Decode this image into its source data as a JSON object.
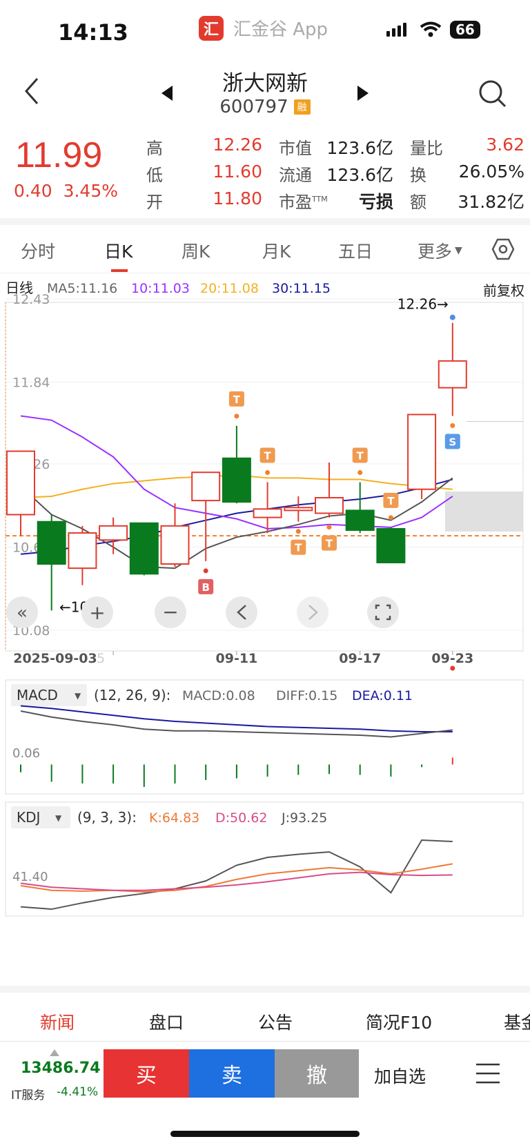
{
  "status": {
    "time": "14:13",
    "app_name": "汇金谷 App",
    "app_logo": "汇",
    "battery": "66"
  },
  "header": {
    "stock_name": "浙大网新",
    "stock_code": "600797",
    "margin_tag": "融"
  },
  "quote": {
    "price": "11.99",
    "change": "0.40",
    "change_pct": "3.45%",
    "stats": [
      {
        "label": "高",
        "value": "12.26"
      },
      {
        "label": "低",
        "value": "11.60"
      },
      {
        "label": "开",
        "value": "11.80"
      }
    ],
    "stats2": [
      {
        "label": "市值",
        "value": "123.6亿"
      },
      {
        "label": "流通",
        "value": "123.6亿"
      },
      {
        "label": "市盈",
        "sup": "TTM",
        "value": "亏损"
      }
    ],
    "stats3": [
      {
        "label": "量比",
        "value": "3.62"
      },
      {
        "label": "换",
        "value": "26.05%"
      },
      {
        "label": "额",
        "value": "31.82亿"
      }
    ]
  },
  "tabs": [
    {
      "label": "分时",
      "active": false
    },
    {
      "label": "日K",
      "active": true
    },
    {
      "label": "周K",
      "active": false
    },
    {
      "label": "月K",
      "active": false
    },
    {
      "label": "五日",
      "active": false
    },
    {
      "label": "更多",
      "active": false
    }
  ],
  "colors": {
    "up": "#e23b2e",
    "down": "#0a7a1e",
    "ma5": "#555555",
    "ma10": "#9b30ff",
    "ma20": "#f5b020",
    "ma30": "#1a1aa0",
    "k": "#f07838",
    "d": "#d84c8a",
    "j": "#555555"
  },
  "chart_data": [
    {
      "type": "candlestick",
      "period_label": "日线",
      "adjust_label": "前复权",
      "legend": {
        "ma5": "MA5:11.16",
        "ma10": "10:11.03",
        "ma20": "20:11.08",
        "ma30": "30:11.15"
      },
      "y_ticks": [
        "12.43",
        "11.84",
        "11.26",
        "10.67",
        "10.08"
      ],
      "ylim": [
        10.08,
        12.43
      ],
      "x_labels": [
        "2025-09-03",
        "09-11",
        "09-17",
        "09-23"
      ],
      "x_label_extra": "5",
      "high_annotation": "12.26→",
      "low_annotation": "←10.25",
      "candles": [
        {
          "o": 10.9,
          "h": 11.3,
          "l": 10.75,
          "c": 11.35
        },
        {
          "o": 10.85,
          "h": 10.9,
          "l": 10.22,
          "c": 10.55
        },
        {
          "o": 10.52,
          "h": 10.82,
          "l": 10.4,
          "c": 10.77
        },
        {
          "o": 10.72,
          "h": 10.88,
          "l": 10.62,
          "c": 10.82
        },
        {
          "o": 10.84,
          "h": 10.84,
          "l": 10.47,
          "c": 10.48
        },
        {
          "o": 10.55,
          "h": 10.98,
          "l": 10.53,
          "c": 10.82
        },
        {
          "o": 11.0,
          "h": 11.18,
          "l": 10.57,
          "c": 11.2
        },
        {
          "o": 11.3,
          "h": 11.53,
          "l": 10.98,
          "c": 10.99
        },
        {
          "o": 10.88,
          "h": 11.13,
          "l": 10.77,
          "c": 10.94
        },
        {
          "o": 10.93,
          "h": 11.03,
          "l": 10.85,
          "c": 10.95
        },
        {
          "o": 10.91,
          "h": 11.27,
          "l": 10.88,
          "c": 11.02
        },
        {
          "o": 10.93,
          "h": 11.13,
          "l": 10.77,
          "c": 10.79
        },
        {
          "o": 10.8,
          "h": 10.81,
          "l": 10.56,
          "c": 10.56
        },
        {
          "o": 11.08,
          "h": 11.61,
          "l": 11.01,
          "c": 11.61
        },
        {
          "o": 11.8,
          "h": 12.26,
          "l": 11.6,
          "c": 11.99
        }
      ],
      "ma5": [
        11.1,
        10.9,
        10.8,
        10.67,
        10.53,
        10.52,
        10.66,
        10.74,
        10.78,
        10.83,
        10.89,
        10.91,
        10.86,
        10.99,
        11.16
      ],
      "ma10": [
        11.6,
        11.57,
        11.45,
        11.31,
        11.08,
        10.95,
        10.91,
        10.87,
        10.8,
        10.81,
        10.83,
        10.82,
        10.81,
        10.88,
        11.03
      ],
      "ma20": [
        11.02,
        11.03,
        11.08,
        11.12,
        11.14,
        11.16,
        11.17,
        11.18,
        11.16,
        11.16,
        11.15,
        11.15,
        11.12,
        11.1,
        11.08
      ],
      "ma30": [
        10.62,
        10.64,
        10.68,
        10.71,
        10.75,
        10.81,
        10.86,
        10.91,
        10.94,
        10.97,
        10.99,
        11.01,
        11.04,
        11.09,
        11.15
      ],
      "reference_line": 10.75,
      "trade_markers": [
        {
          "index": 6,
          "label": "B",
          "side": "below"
        },
        {
          "index": 7,
          "label": "T",
          "side": "above"
        },
        {
          "index": 8,
          "label": "T",
          "side": "above"
        },
        {
          "index": 9,
          "label": "T",
          "side": "below"
        },
        {
          "index": 10,
          "label": "T",
          "side": "below"
        },
        {
          "index": 11,
          "label": "T",
          "side": "above"
        },
        {
          "index": 12,
          "label": "T",
          "side": "above"
        },
        {
          "index": 14,
          "label": "S",
          "side": "below"
        }
      ]
    },
    {
      "type": "bar",
      "indicator": "MACD",
      "params": "(12, 26, 9):",
      "legend": {
        "macd": "MACD:0.08",
        "diff": "DIFF:0.15",
        "dea": "DEA:0.11"
      },
      "y_tick": "0.06",
      "diff": [
        0.62,
        0.55,
        0.5,
        0.46,
        0.41,
        0.39,
        0.39,
        0.38,
        0.37,
        0.36,
        0.35,
        0.34,
        0.32,
        0.36,
        0.4
      ],
      "dea": [
        0.68,
        0.65,
        0.61,
        0.57,
        0.53,
        0.5,
        0.48,
        0.46,
        0.44,
        0.43,
        0.42,
        0.41,
        0.39,
        0.38,
        0.38
      ],
      "macd_bars": [
        -0.09,
        -0.2,
        -0.22,
        -0.22,
        -0.26,
        -0.22,
        -0.18,
        -0.16,
        -0.14,
        -0.12,
        -0.11,
        -0.12,
        -0.14,
        -0.03,
        0.08
      ]
    },
    {
      "type": "line",
      "indicator": "KDJ",
      "params": "(9, 3, 3):",
      "legend": {
        "k": "K:64.83",
        "d": "D:50.62",
        "j": "J:93.25"
      },
      "y_tick": "41.40",
      "k": [
        37,
        31,
        30,
        31,
        29,
        31,
        36,
        45,
        52,
        56,
        60,
        57,
        52,
        58,
        64.83
      ],
      "d": [
        40,
        35,
        33,
        31,
        31,
        33,
        35,
        38,
        42,
        47,
        52,
        54,
        51,
        50,
        50.62
      ],
      "j": [
        10,
        7,
        15,
        22,
        27,
        33,
        43,
        63,
        73,
        77,
        80,
        61,
        28,
        95,
        93.25
      ]
    }
  ],
  "chart_tools": {
    "ordinal_label": ""
  },
  "news_tabs": [
    "新闻",
    "盘口",
    "公告",
    "简况F10",
    "基金"
  ],
  "bottom": {
    "index_value": "13486.74",
    "index_name": "IT服务",
    "index_change": "-4.41%",
    "buy": "买",
    "sell": "卖",
    "cancel": "撤",
    "watch": "加自选"
  }
}
